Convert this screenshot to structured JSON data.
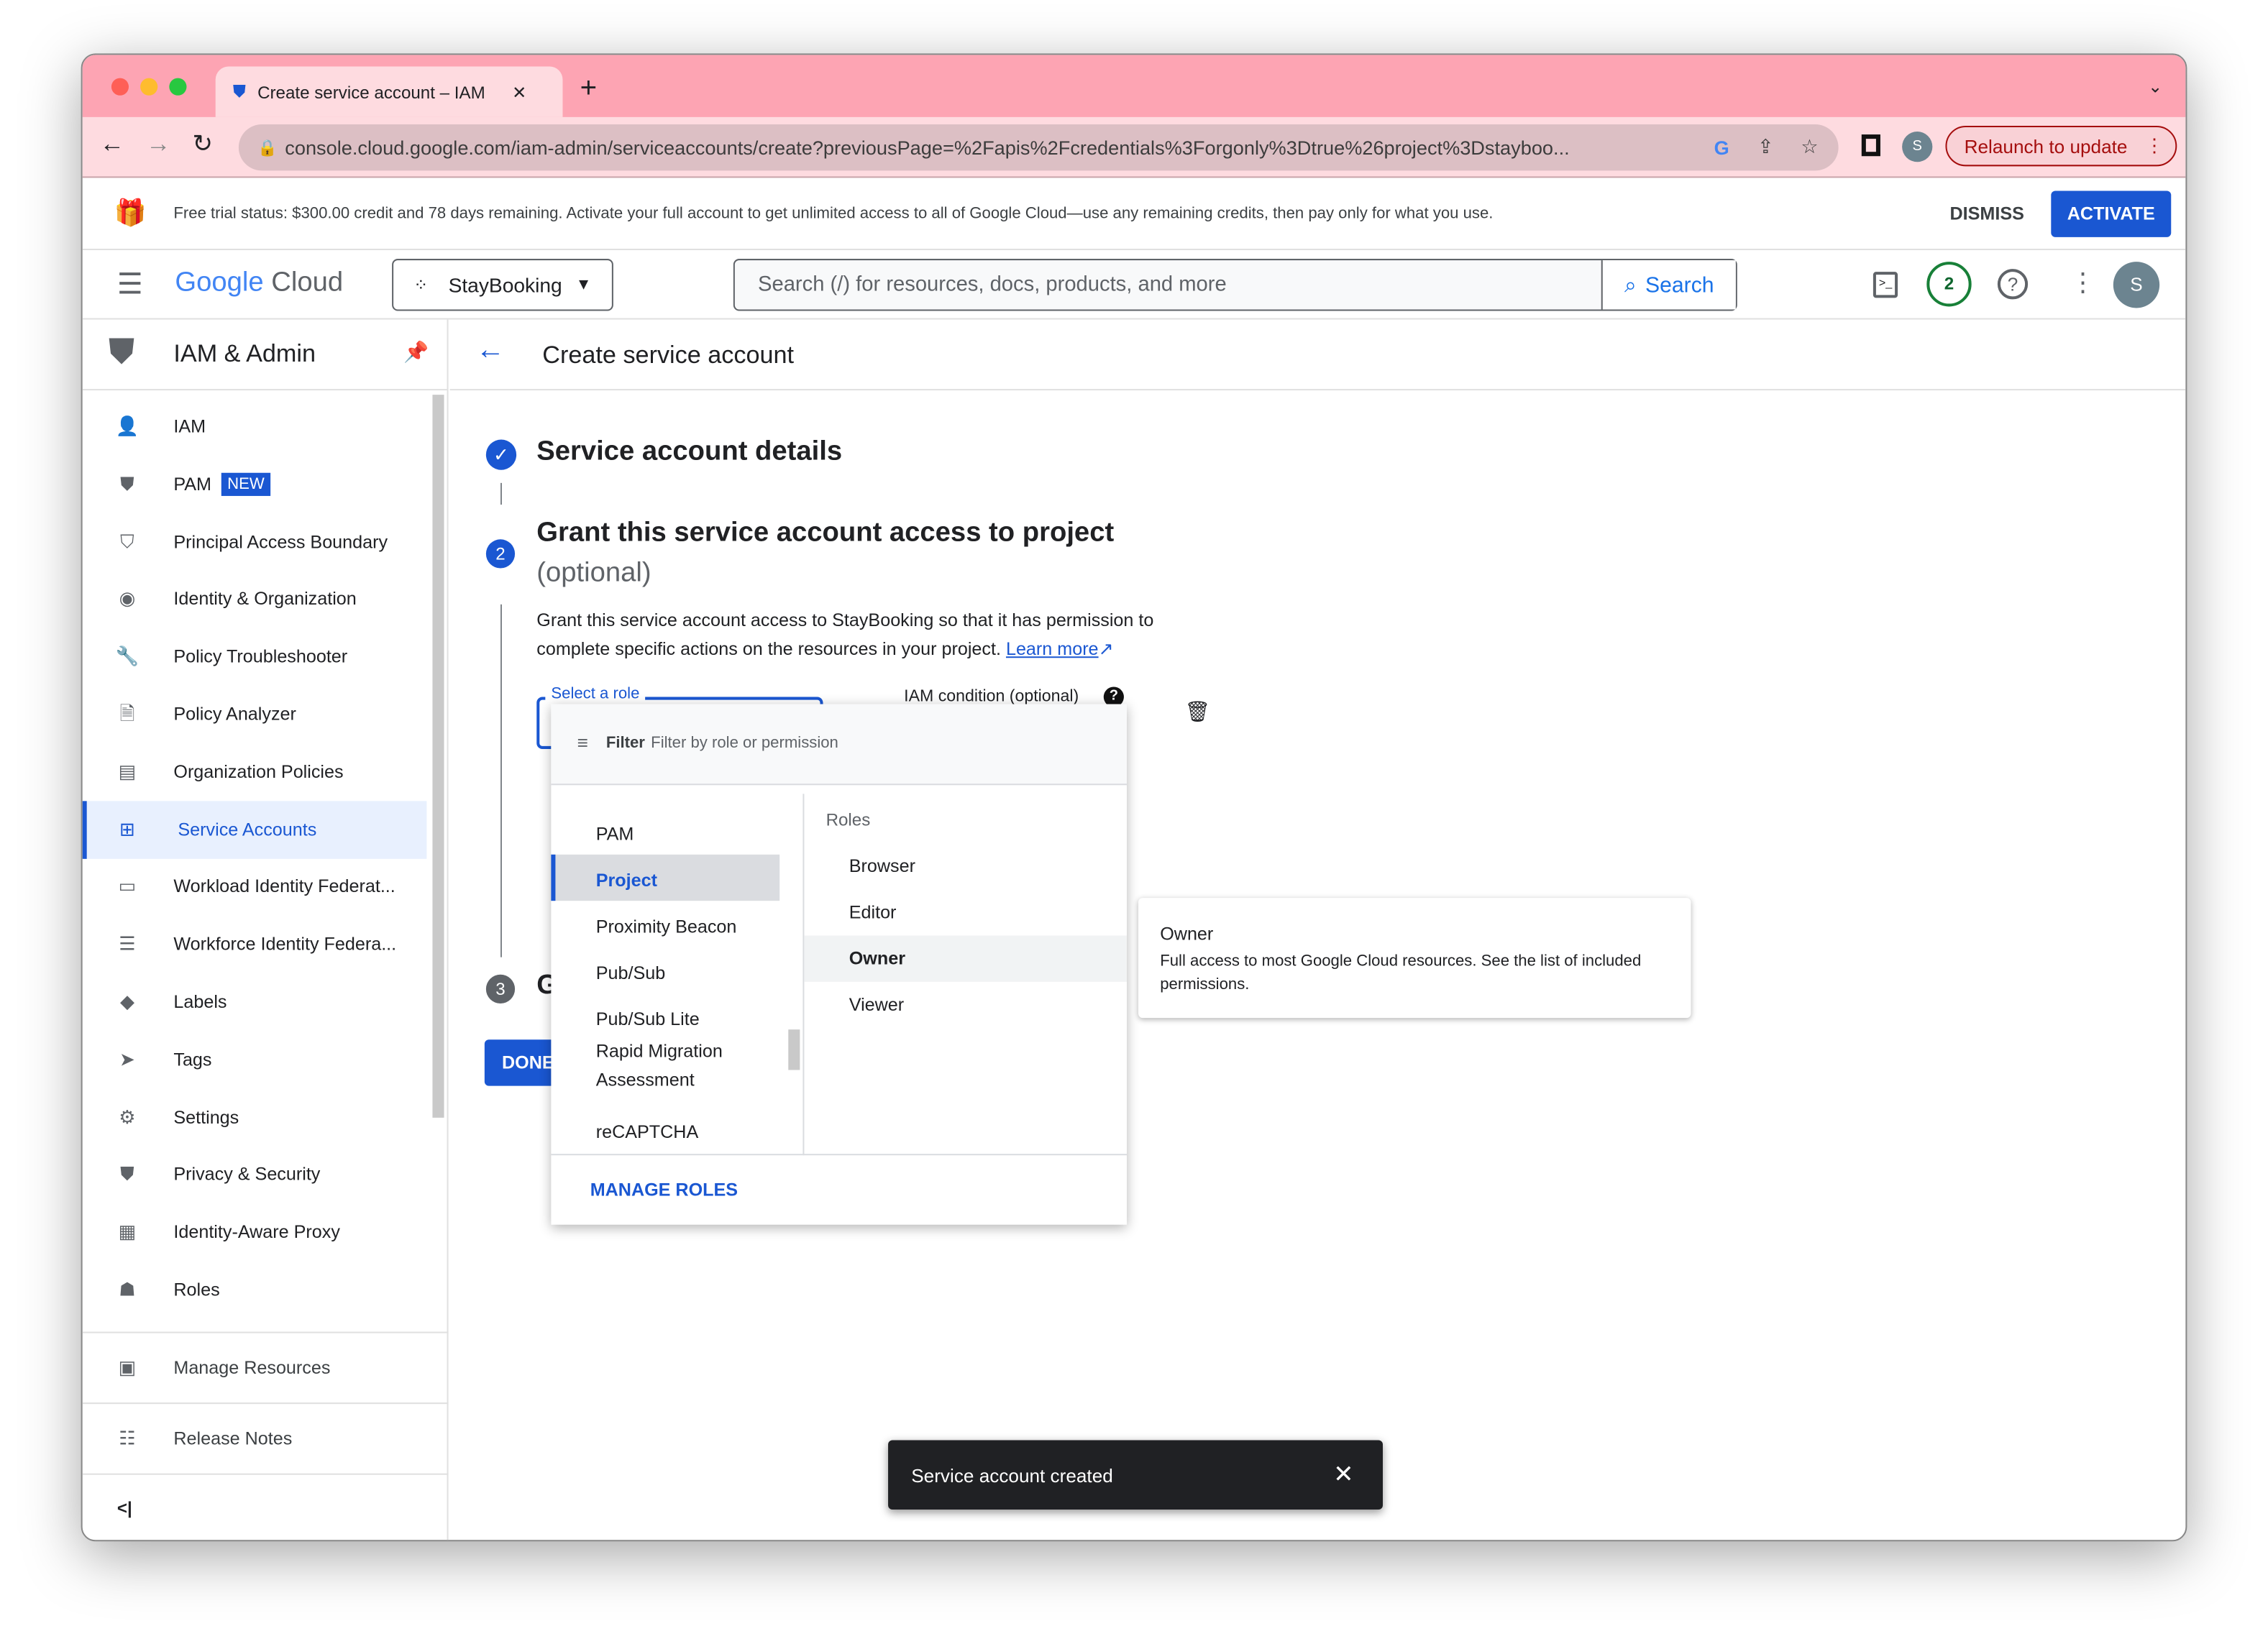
{
  "browser": {
    "tab_title": "Create service account – IAM",
    "url": "console.cloud.google.com/iam-admin/serviceaccounts/create?previousPage=%2Fapis%2Fcredentials%3Forgonly%3Dtrue%26project%3Dstayboo...",
    "relaunch": "Relaunch to update",
    "profile": "S"
  },
  "banner": {
    "text": "Free trial status: $300.00 credit and 78 days remaining. Activate your full account to get unlimited access to all of Google Cloud—use any remaining credits, then pay only for what you use.",
    "dismiss": "DISMISS",
    "activate": "ACTIVATE"
  },
  "header": {
    "logo_google": "Google",
    "logo_cloud": "Cloud",
    "project": "StayBooking",
    "search_placeholder": "Search (/) for resources, docs, products, and more",
    "search_button": "Search",
    "notifications": "2",
    "avatar": "S"
  },
  "sidebar": {
    "title": "IAM & Admin",
    "items": [
      {
        "label": "IAM",
        "icon": "person-add-icon"
      },
      {
        "label": "PAM",
        "badge": "NEW",
        "icon": "shield-icon"
      },
      {
        "label": "Principal Access Boundary",
        "icon": "shield-lock-icon"
      },
      {
        "label": "Identity & Organization",
        "icon": "account-circle-icon"
      },
      {
        "label": "Policy Troubleshooter",
        "icon": "wrench-icon"
      },
      {
        "label": "Policy Analyzer",
        "icon": "document-search-icon"
      },
      {
        "label": "Organization Policies",
        "icon": "list-box-icon"
      },
      {
        "label": "Service Accounts",
        "icon": "service-account-icon",
        "active": true
      },
      {
        "label": "Workload Identity Federat...",
        "icon": "id-card-icon"
      },
      {
        "label": "Workforce Identity Federa...",
        "icon": "list-icon"
      },
      {
        "label": "Labels",
        "icon": "label-icon"
      },
      {
        "label": "Tags",
        "icon": "tag-icon"
      },
      {
        "label": "Settings",
        "icon": "gear-icon"
      },
      {
        "label": "Privacy & Security",
        "icon": "shield-icon"
      },
      {
        "label": "Identity-Aware Proxy",
        "icon": "proxy-icon"
      },
      {
        "label": "Roles",
        "icon": "roles-icon"
      }
    ],
    "manage_resources": "Manage Resources",
    "release_notes": "Release Notes",
    "collapse": "<|"
  },
  "main": {
    "title": "Create service account",
    "step1": "Service account details",
    "step2_title": "Grant this service account access to project",
    "step2_optional": "(optional)",
    "step2_num": "2",
    "step2_desc": "Grant this service account access to StayBooking so that it has permission to complete specific actions on the resources in your project.",
    "learn_more": "Learn more",
    "select_role_label": "Select a role",
    "iam_condition": "IAM condition (optional)",
    "step3_num": "3",
    "step3_partial": "G",
    "done": "DONE"
  },
  "role_menu": {
    "filter_label": "Filter",
    "filter_placeholder": "Filter by role or permission",
    "services": [
      "PAM",
      "Project",
      "Proximity Beacon",
      "Pub/Sub",
      "Pub/Sub Lite",
      "Rapid Migration Assessment",
      "reCAPTCHA"
    ],
    "selected_service": "Project",
    "roles_header": "Roles",
    "roles": [
      "Browser",
      "Editor",
      "Owner",
      "Viewer"
    ],
    "hovered_role": "Owner",
    "manage_roles": "MANAGE ROLES"
  },
  "tooltip": {
    "title": "Owner",
    "desc": "Full access to most Google Cloud resources. See the list of included permissions."
  },
  "toast": {
    "text": "Service account created",
    "close": "✕"
  }
}
